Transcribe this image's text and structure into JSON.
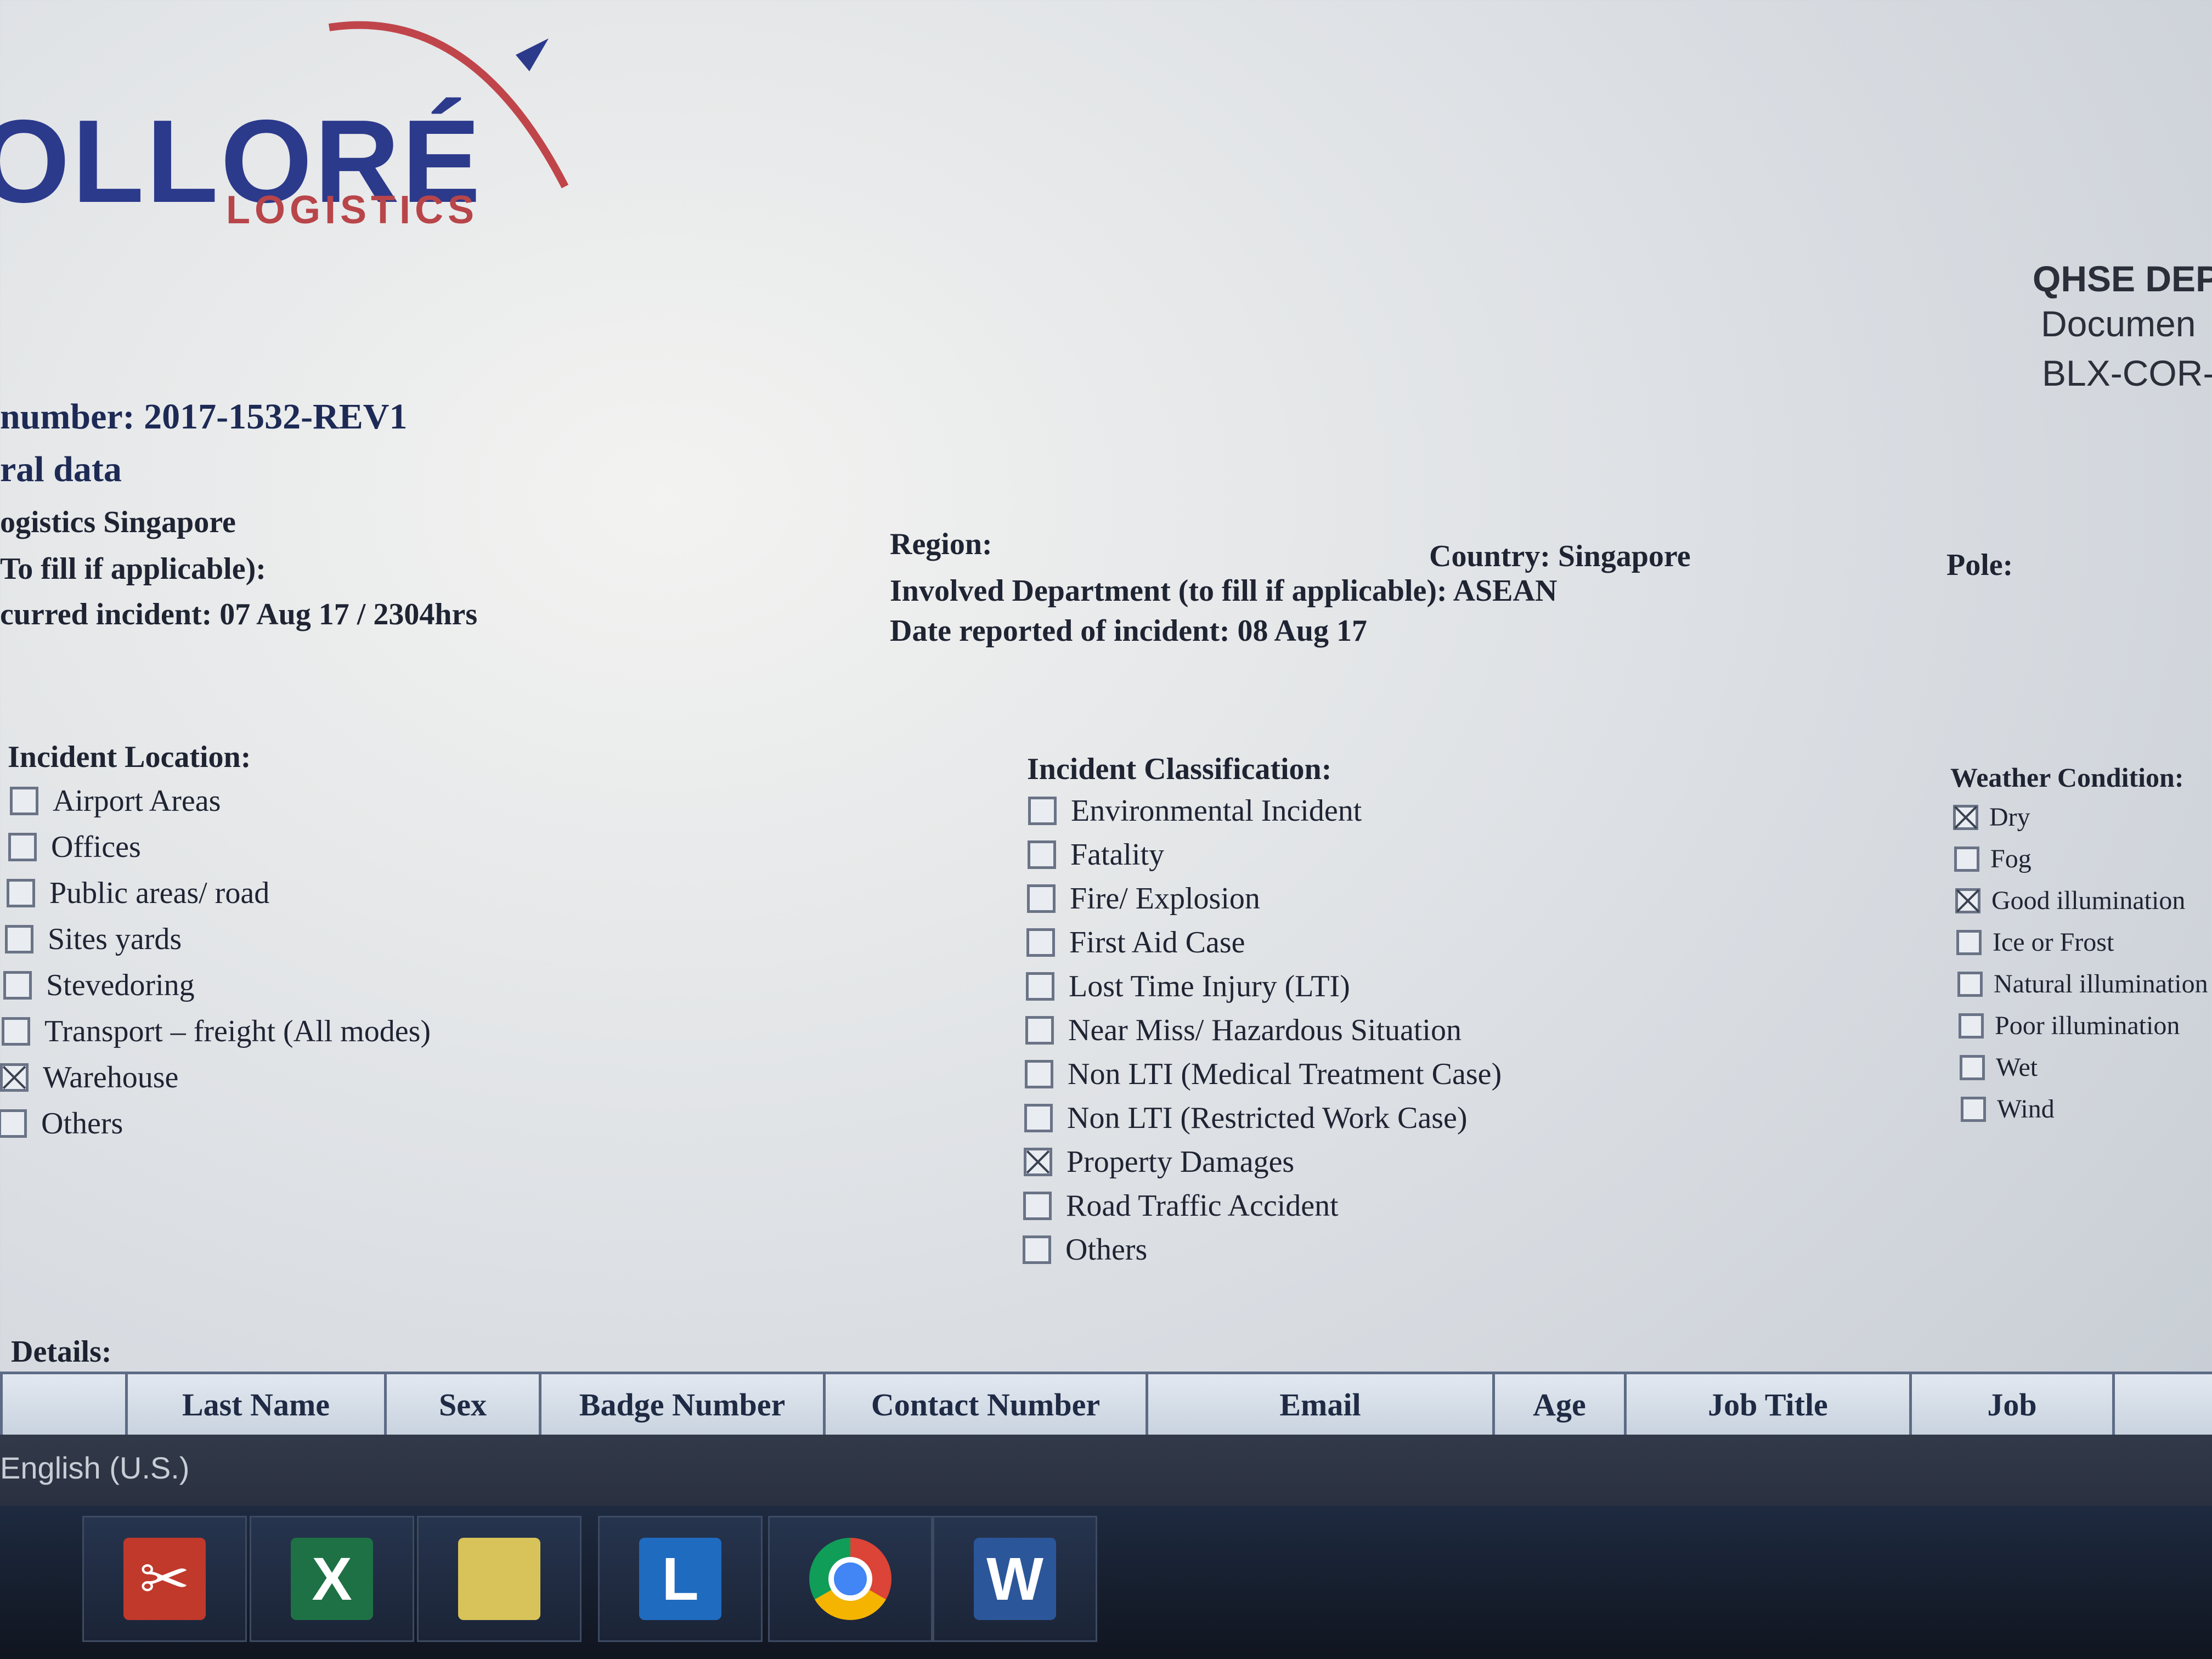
{
  "logo": {
    "main": "OLLORÉ",
    "sub": "LOGISTICS"
  },
  "qhse": {
    "line1": "QHSE DEPA",
    "line2": "Documen",
    "line3": "BLX-COR-"
  },
  "report": {
    "number_line": "number: 2017-1532-REV1",
    "section_title": "ral data",
    "entity": "ogistics Singapore",
    "to_fill": "To fill if applicable):",
    "occurred": "curred incident: 07 Aug 17 / 2304hrs",
    "region": "Region:",
    "involved_dept": "Involved Department (to fill if applicable): ASEAN",
    "date_reported": "Date reported of incident: 08 Aug 17",
    "country": "Country: Singapore",
    "pole": "Pole:"
  },
  "incident_location": {
    "title": "Incident Location:",
    "items": [
      {
        "label": "Airport Areas",
        "checked": false
      },
      {
        "label": "Offices",
        "checked": false
      },
      {
        "label": "Public areas/ road",
        "checked": false
      },
      {
        "label": "Sites yards",
        "checked": false
      },
      {
        "label": "Stevedoring",
        "checked": false
      },
      {
        "label": "Transport – freight (All modes)",
        "checked": false
      },
      {
        "label": "Warehouse",
        "checked": true
      },
      {
        "label": "Others",
        "checked": false
      }
    ]
  },
  "incident_classification": {
    "title": "Incident Classification:",
    "items": [
      {
        "label": "Environmental Incident",
        "checked": false
      },
      {
        "label": "Fatality",
        "checked": false
      },
      {
        "label": "Fire/ Explosion",
        "checked": false
      },
      {
        "label": "First Aid Case",
        "checked": false
      },
      {
        "label": "Lost Time Injury (LTI)",
        "checked": false
      },
      {
        "label": "Near Miss/ Hazardous Situation",
        "checked": false
      },
      {
        "label": "Non LTI (Medical Treatment Case)",
        "checked": false
      },
      {
        "label": "Non LTI (Restricted Work Case)",
        "checked": false
      },
      {
        "label": "Property Damages",
        "checked": true
      },
      {
        "label": "Road Traffic Accident",
        "checked": false
      },
      {
        "label": "Others",
        "checked": false
      }
    ]
  },
  "weather_condition": {
    "title": "Weather Condition:",
    "items": [
      {
        "label": "Dry",
        "checked": true
      },
      {
        "label": "Fog",
        "checked": false
      },
      {
        "label": "Good illumination",
        "checked": true
      },
      {
        "label": "Ice or Frost",
        "checked": false
      },
      {
        "label": "Natural illumination",
        "checked": false
      },
      {
        "label": "Poor illumination",
        "checked": false
      },
      {
        "label": "Wet",
        "checked": false
      },
      {
        "label": "Wind",
        "checked": false
      }
    ]
  },
  "details": {
    "label": "Details:",
    "columns": [
      "",
      "Last Name",
      "Sex",
      "Badge Number",
      "Contact Number",
      "Email",
      "Age",
      "Job Title",
      "Job",
      ""
    ]
  },
  "statusbar": {
    "language": "English (U.S.)"
  },
  "taskbar": {
    "apps": [
      {
        "name": "snipping-tool-icon",
        "glyph": "✂",
        "color": "#c0392b"
      },
      {
        "name": "excel-icon",
        "glyph": "X",
        "color": "#1e7145"
      },
      {
        "name": "sticky-notes-icon",
        "glyph": "",
        "color": "#d8c35a"
      },
      {
        "name": "lync-icon",
        "glyph": "L",
        "color": "#1f6bc0"
      },
      {
        "name": "chrome-icon",
        "glyph": "",
        "color": "#db4437"
      },
      {
        "name": "word-icon",
        "glyph": "W",
        "color": "#2b579a"
      }
    ]
  }
}
